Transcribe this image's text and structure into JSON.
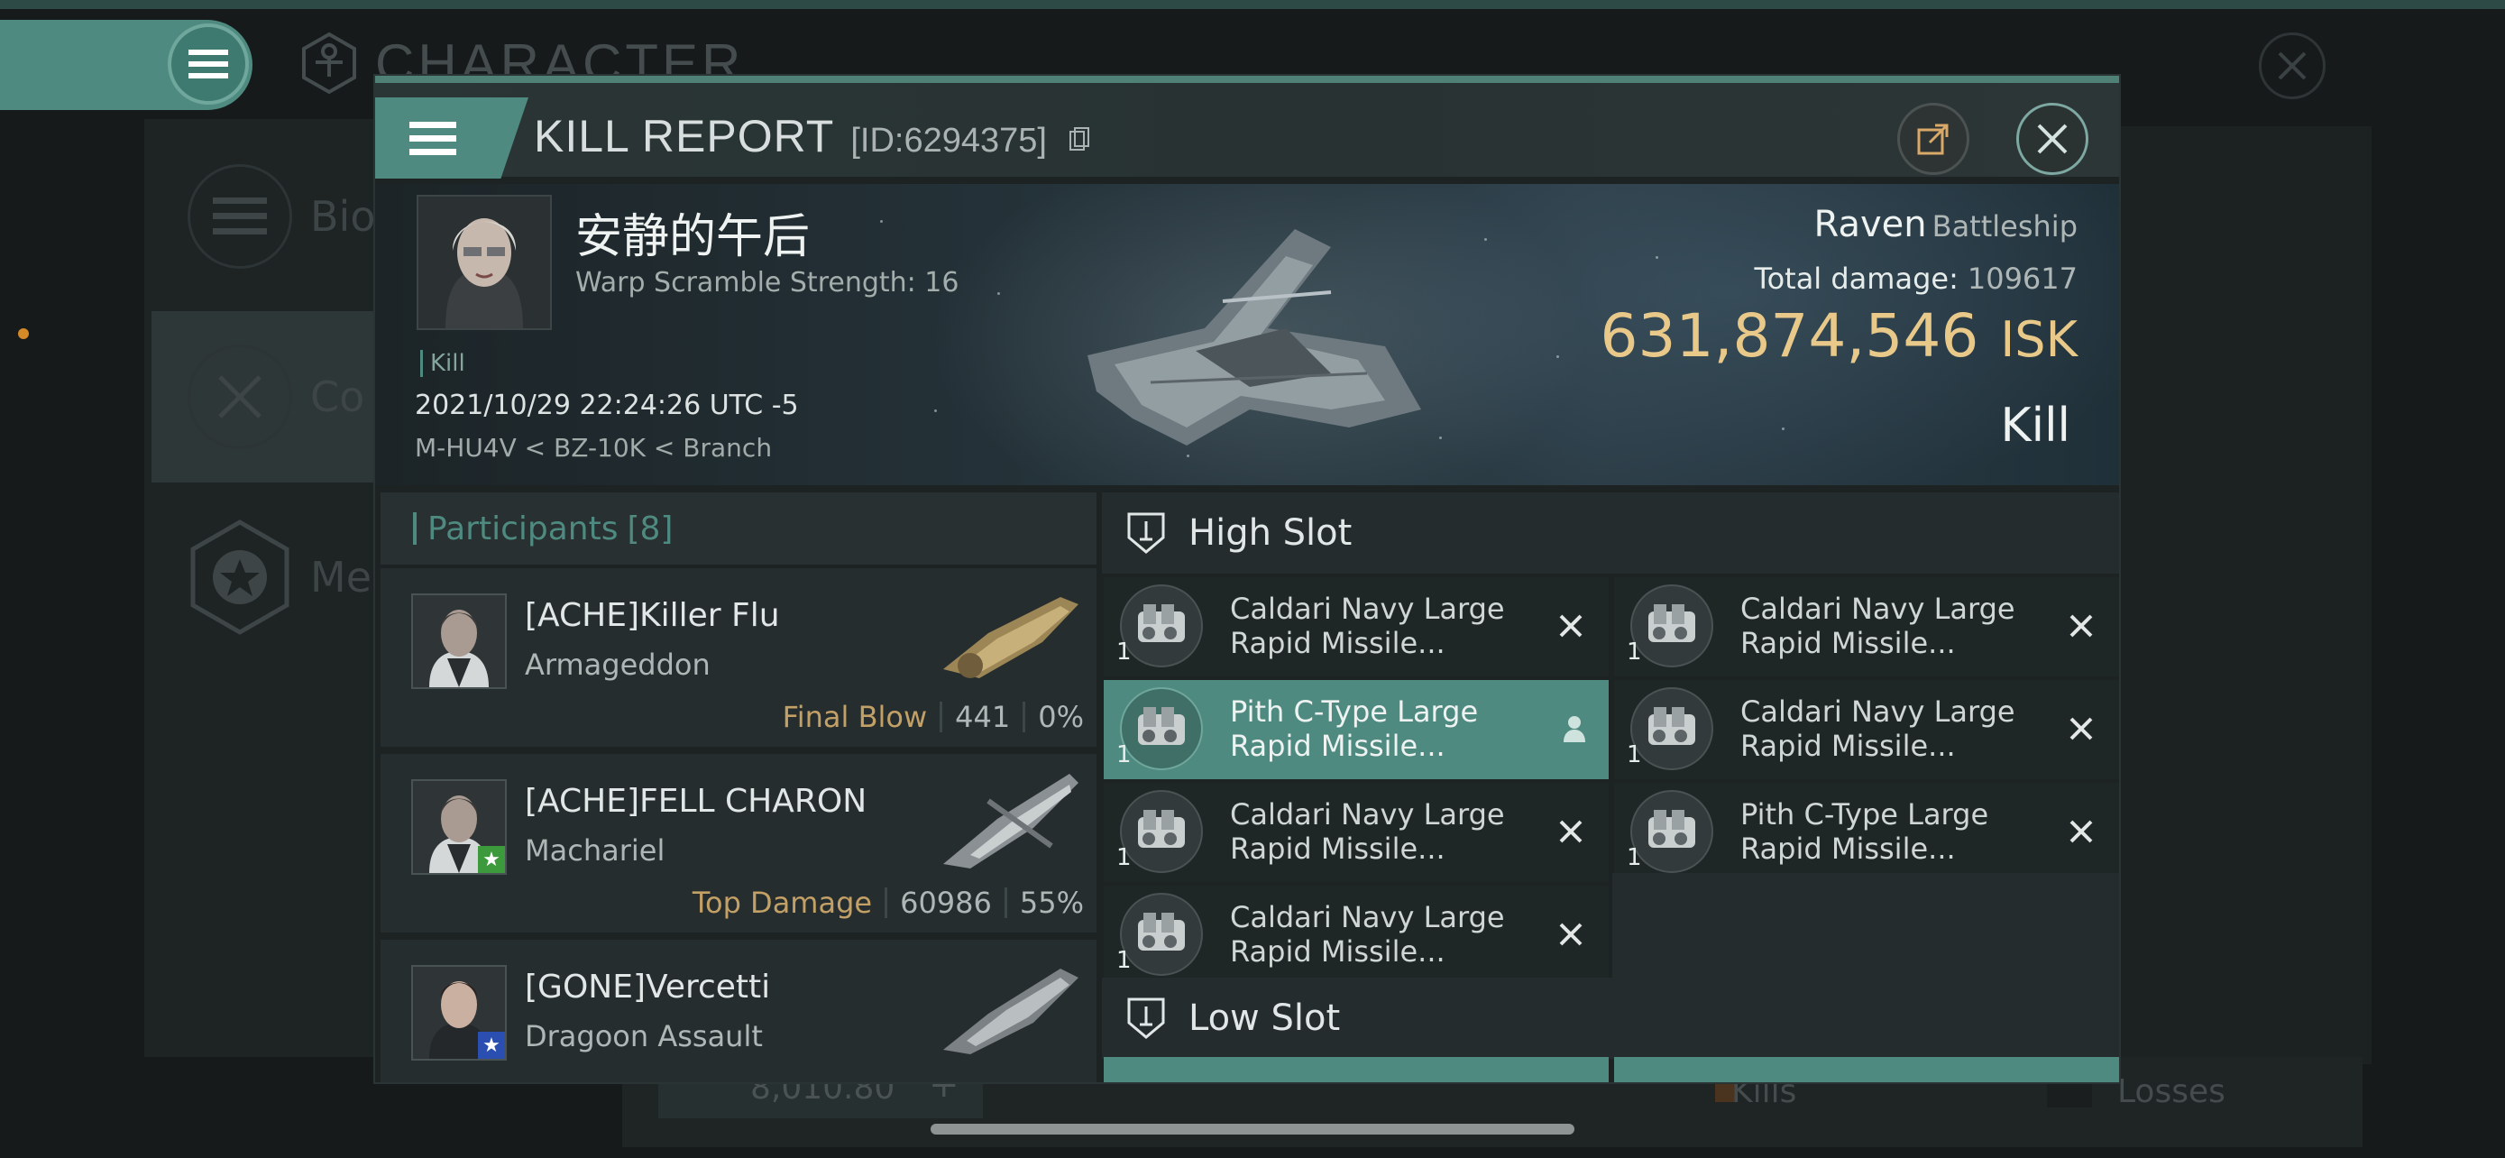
{
  "background": {
    "title": "CHARACTER",
    "side_items": [
      {
        "label": "Bio",
        "icon": "list-icon"
      },
      {
        "label": "Co",
        "icon": "crossed-swords-icon"
      },
      {
        "label": "Me",
        "icon": "star-badge-icon"
      }
    ],
    "bottom_value": "8,010.80",
    "bottom_plus": "+",
    "kills_label": "Kills",
    "losses_label": "Losses"
  },
  "header": {
    "title": "KILL REPORT",
    "report_id": "[ID:6294375]",
    "icons": [
      "menu-icon",
      "copy-icon",
      "share-icon",
      "close-icon"
    ]
  },
  "victim": {
    "name": "安静的午后",
    "warp": "Warp Scramble Strength: 16",
    "tag": "Kill",
    "datetime": "2021/10/29 22:24:26 UTC -5",
    "location": "M-HU4V < BZ-10K < Branch",
    "ship": "Raven",
    "ship_class": "Battleship",
    "damage_label": "Total damage:",
    "damage_value": "109617",
    "isk_value": "631,874,546",
    "isk_unit": "ISK",
    "outcome": "Kill"
  },
  "participants": {
    "title": "Participants",
    "count": "[8]",
    "rows": [
      {
        "name": "[ACHE]Killer Flu",
        "ship": "Armageddon",
        "role": "Final Blow",
        "damage": "441",
        "percent": "0%",
        "badge": ""
      },
      {
        "name": "[ACHE]FELL CHARON",
        "ship": "Machariel",
        "role": "Top Damage",
        "damage": "60986",
        "percent": "55%",
        "badge": "green-star"
      },
      {
        "name": "[GONE]Vercetti",
        "ship": "Dragoon Assault",
        "role": "",
        "damage": "",
        "percent": "",
        "badge": "blue-star"
      }
    ]
  },
  "slots": {
    "high_title": "High Slot",
    "low_title": "Low Slot",
    "high_modules": [
      {
        "line1": "Caldari Navy Large",
        "line2": "Rapid Missile...",
        "qty": "1",
        "state": "destroyed"
      },
      {
        "line1": "Caldari Navy Large",
        "line2": "Rapid Missile...",
        "qty": "1",
        "state": "destroyed"
      },
      {
        "line1": "Pith C-Type Large",
        "line2": "Rapid Missile...",
        "qty": "1",
        "state": "dropped"
      },
      {
        "line1": "Caldari Navy Large",
        "line2": "Rapid Missile...",
        "qty": "1",
        "state": "destroyed"
      },
      {
        "line1": "Caldari Navy Large",
        "line2": "Rapid Missile...",
        "qty": "1",
        "state": "destroyed"
      },
      {
        "line1": "Pith C-Type Large",
        "line2": "Rapid Missile...",
        "qty": "1",
        "state": "destroyed"
      },
      {
        "line1": "Caldari Navy Large",
        "line2": "Rapid Missile...",
        "qty": "1",
        "state": "destroyed"
      }
    ]
  },
  "colors": {
    "accent": "#4f8a80",
    "isk": "#e8c98a",
    "role_gold": "#c2a066",
    "panel": "#1d2222"
  }
}
